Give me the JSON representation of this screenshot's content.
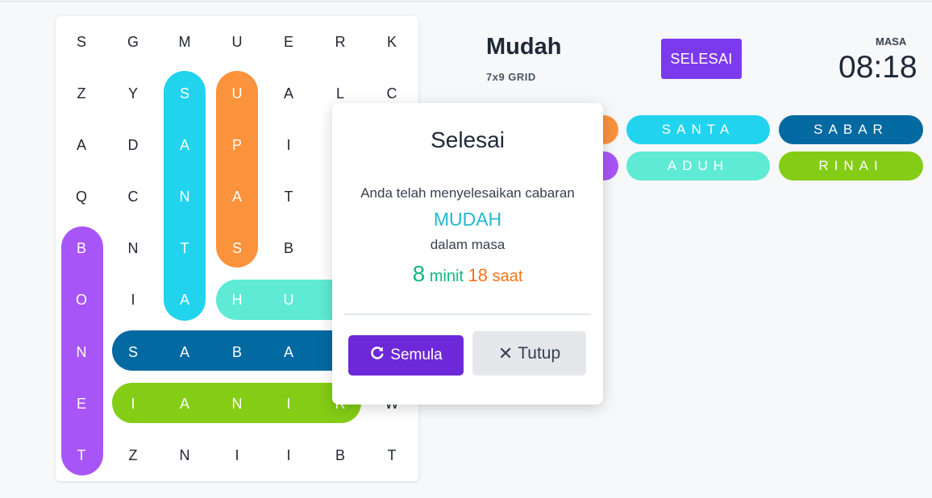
{
  "header": {
    "level_title": "Mudah",
    "grid_size": "7x9 GRID",
    "done_button": "SELESAI",
    "timer_label": "MASA",
    "timer_value": "08:18"
  },
  "grid": {
    "rows": [
      [
        "S",
        "G",
        "M",
        "U",
        "E",
        "R",
        "K"
      ],
      [
        "Z",
        "Y",
        "S",
        "U",
        "A",
        "L",
        "C"
      ],
      [
        "A",
        "D",
        "A",
        "P",
        "I",
        "",
        ""
      ],
      [
        "Q",
        "C",
        "N",
        "A",
        "T",
        "",
        ""
      ],
      [
        "B",
        "N",
        "T",
        "S",
        "B",
        "",
        ""
      ],
      [
        "O",
        "I",
        "A",
        "H",
        "U",
        "",
        ""
      ],
      [
        "N",
        "S",
        "A",
        "B",
        "A",
        "",
        ""
      ],
      [
        "E",
        "I",
        "A",
        "N",
        "I",
        "R",
        "W"
      ],
      [
        "T",
        "Z",
        "N",
        "I",
        "I",
        "B",
        "T"
      ]
    ]
  },
  "words": [
    {
      "label": "SANTA",
      "color": "#22d3ee"
    },
    {
      "label": "SABAR",
      "color": "#0369a1"
    },
    {
      "label": "ADUH",
      "color": "#5eead4"
    },
    {
      "label": "RINAI",
      "color": "#84cc16"
    }
  ],
  "partial_pills": [
    {
      "color": "#fb923c"
    },
    {
      "color": "#a855f7"
    }
  ],
  "modal": {
    "title": "Selesai",
    "line1": "Anda telah menyelesaikan cabaran",
    "level": "MUDAH",
    "line2": "dalam masa",
    "minutes": "8",
    "minutes_label": "minit",
    "seconds": "18",
    "seconds_label": "saat",
    "restart_button": "Semula",
    "close_button": "Tutup"
  },
  "colors": {
    "accent_purple": "#7c3aed",
    "santa": "#22d3ee",
    "upas": "#fb923c",
    "bonet": "#a855f7",
    "aduh": "#5eead4",
    "sabar": "#0369a1",
    "rinai": "#84cc16"
  }
}
